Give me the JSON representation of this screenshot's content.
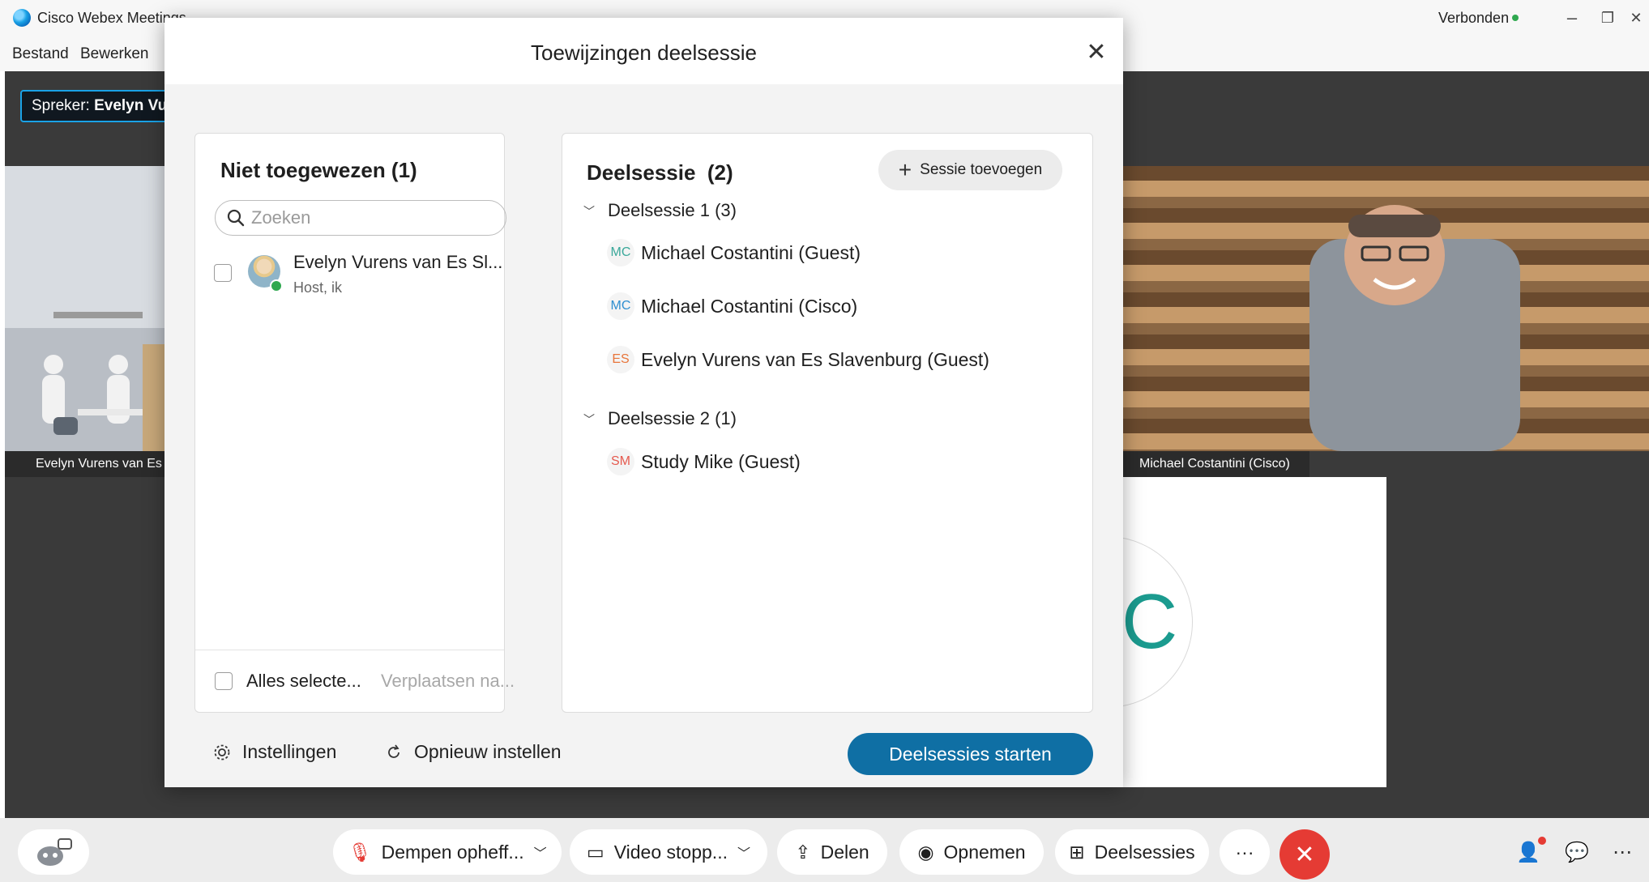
{
  "window": {
    "title": "Cisco Webex Meetings",
    "status": "Verbonden",
    "status_color": "#2fa84f",
    "controls": {
      "minimize": "–",
      "restore": "❐",
      "close": "✕"
    }
  },
  "menubar": {
    "items": [
      "Bestand",
      "Bewerken"
    ]
  },
  "stage": {
    "speaker_prefix": "Spreker: ",
    "speaker_name": "Evelyn Vu",
    "tile_left_name": "Evelyn Vurens van Es",
    "tile_right_name": "Michael Costantini (Cisco)",
    "avatar_letter": "C"
  },
  "modal": {
    "title": "Toewijzingen deelsessie",
    "close_icon": "close-icon",
    "unassigned": {
      "title": "Niet toegewezen (1)",
      "search_placeholder": "Zoeken",
      "members": [
        {
          "name": "Evelyn Vurens van Es Sl...",
          "role": "Host, ik"
        }
      ],
      "select_all_label": "Alles selecte...",
      "move_to_label": "Verplaatsen na..."
    },
    "sessions": {
      "title": "Deelsessie  (2)",
      "add_button_label": "Sessie toevoegen",
      "groups": [
        {
          "label": "Deelsessie 1 (3)",
          "members": [
            {
              "initials": "MC",
              "name": "Michael Costantini (Guest)",
              "color": "#3aa89a"
            },
            {
              "initials": "MC",
              "name": "Michael Costantini (Cisco)",
              "color": "#2e8fd0"
            },
            {
              "initials": "ES",
              "name": "Evelyn Vurens van Es Slavenburg (Guest)",
              "color": "#e8753a"
            }
          ]
        },
        {
          "label": "Deelsessie 2 (1)",
          "members": [
            {
              "initials": "SM",
              "name": "Study Mike (Guest)",
              "color": "#e55a4f"
            }
          ]
        }
      ]
    },
    "footer": {
      "settings_label": "Instellingen",
      "reset_label": "Opnieuw instellen",
      "start_label": "Deelsessies starten",
      "start_color": "#0f6fa4"
    }
  },
  "controls": {
    "mute_label": "Dempen opheff...",
    "video_label": "Video stopp...",
    "share_label": "Delen",
    "record_label": "Opnemen",
    "breakout_label": "Deelsessies",
    "more_label": "···",
    "end_color": "#e53b34"
  }
}
